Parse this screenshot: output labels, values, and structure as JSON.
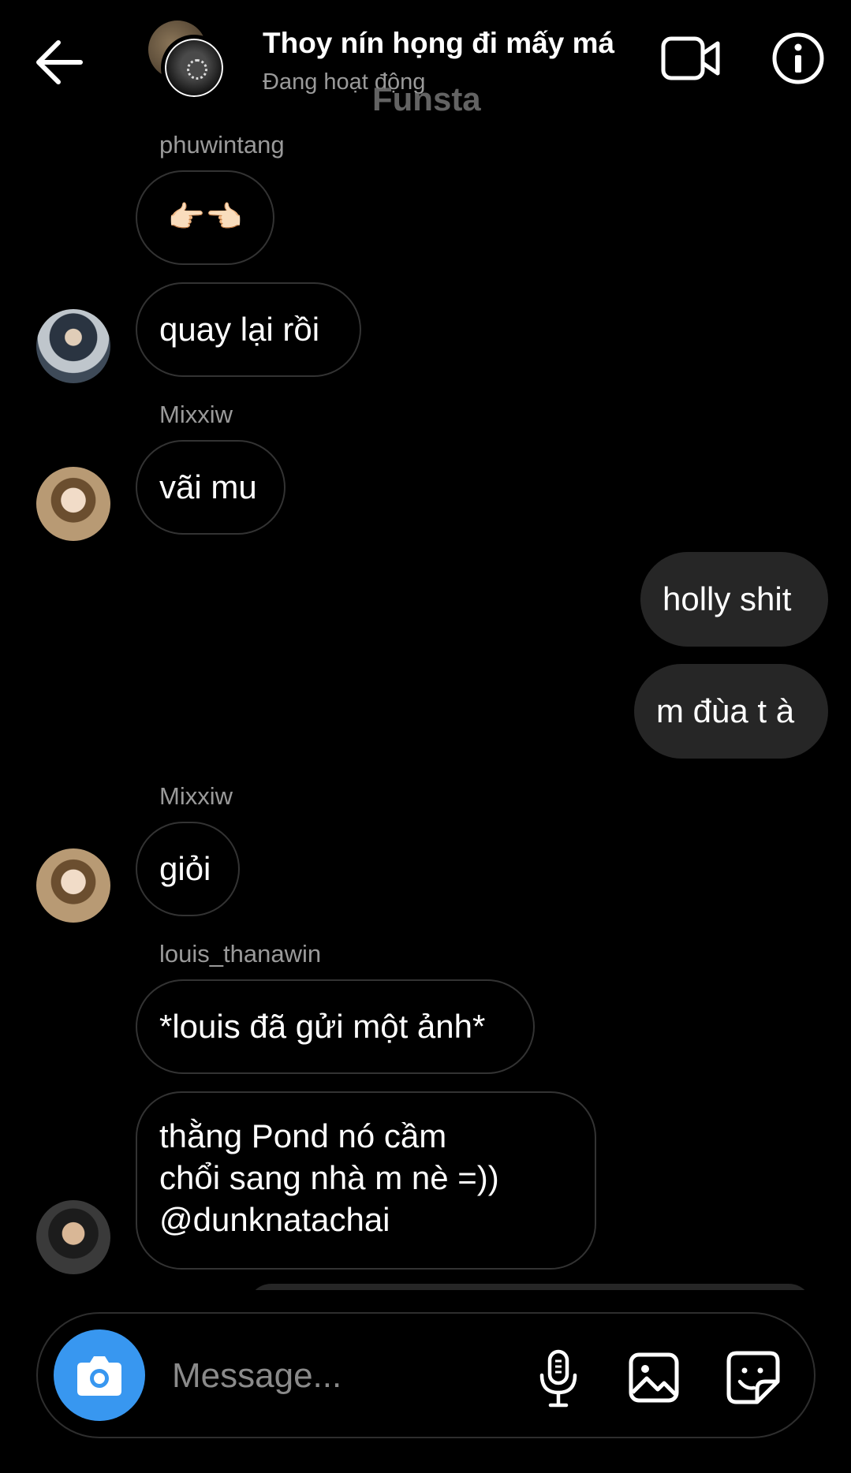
{
  "header": {
    "title": "Thoy nín họng đi mấy má",
    "status": "Đang hoạt động",
    "watermark": "Funsta"
  },
  "messages": {
    "m1_sender": "phuwintang",
    "m1_text": "👉🏻👈🏻",
    "m2_text": "quay lại rồi",
    "m3_sender": "Mixxiw",
    "m3_text": "vãi mu",
    "m4_text": "holly shit",
    "m5_text": "m đùa t à",
    "m6_sender": "Mixxiw",
    "m6_text": "giỏi",
    "m7_sender": "louis_thanawin",
    "m7_text": "*louis đã gửi một ảnh*",
    "m8_line1": "thằng Pond nó cầm",
    "m8_line2": "chổi sang nhà m nè =))",
    "m8_line3": "@dunknatachai"
  },
  "composer": {
    "placeholder": "Message..."
  },
  "colors": {
    "accent": "#3897f0",
    "own_bubble": "#262626",
    "bubble_border": "#333333",
    "muted_text": "#9a9a9a"
  },
  "icons": [
    "back-arrow-icon",
    "video-call-icon",
    "info-icon",
    "camera-icon",
    "microphone-icon",
    "gallery-icon",
    "sticker-icon"
  ]
}
